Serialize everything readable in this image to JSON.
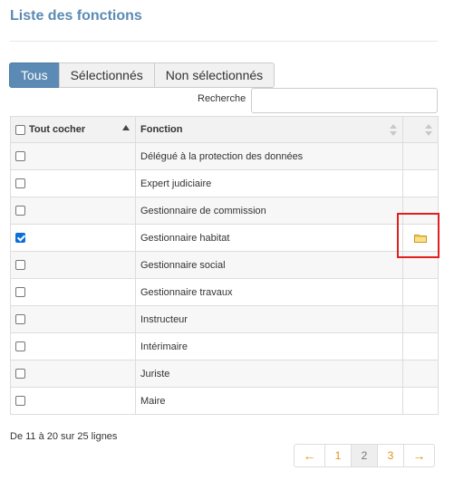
{
  "page": {
    "title": "Liste des fonctions"
  },
  "tabs": [
    {
      "label": "Tous",
      "active": true
    },
    {
      "label": "Sélectionnés",
      "active": false
    },
    {
      "label": "Non sélectionnés",
      "active": false
    }
  ],
  "search": {
    "label": "Recherche",
    "value": "",
    "placeholder": ""
  },
  "table": {
    "headers": {
      "check_all": "Tout cocher",
      "function": "Fonction",
      "actions": ""
    },
    "sort": {
      "column": "check_all",
      "direction": "ascending"
    },
    "rows": [
      {
        "label": "Délégué à la protection des données",
        "checked": false,
        "has_folder": false
      },
      {
        "label": "Expert judiciaire",
        "checked": false,
        "has_folder": false
      },
      {
        "label": "Gestionnaire de commission",
        "checked": false,
        "has_folder": false
      },
      {
        "label": "Gestionnaire habitat",
        "checked": true,
        "has_folder": true
      },
      {
        "label": "Gestionnaire social",
        "checked": false,
        "has_folder": false
      },
      {
        "label": "Gestionnaire travaux",
        "checked": false,
        "has_folder": false
      },
      {
        "label": "Instructeur",
        "checked": false,
        "has_folder": false
      },
      {
        "label": "Intérimaire",
        "checked": false,
        "has_folder": false
      },
      {
        "label": "Juriste",
        "checked": false,
        "has_folder": false
      },
      {
        "label": "Maire",
        "checked": false,
        "has_folder": false
      }
    ]
  },
  "summary": {
    "text": "De 11 à 20 sur 25 lignes"
  },
  "pagination": {
    "prev": "←",
    "next": "→",
    "pages": [
      {
        "label": "1"
      },
      {
        "label": "2",
        "current": true
      },
      {
        "label": "3"
      }
    ]
  },
  "icons": {
    "folder": "folder-icon",
    "sort": "sort-icon"
  },
  "colors": {
    "accent": "#5b8ab4",
    "pagination_link": "#e0921a",
    "checkbox_checked": "#0a6fd8",
    "highlight": "#e02020",
    "folder": "#f5c84c"
  }
}
